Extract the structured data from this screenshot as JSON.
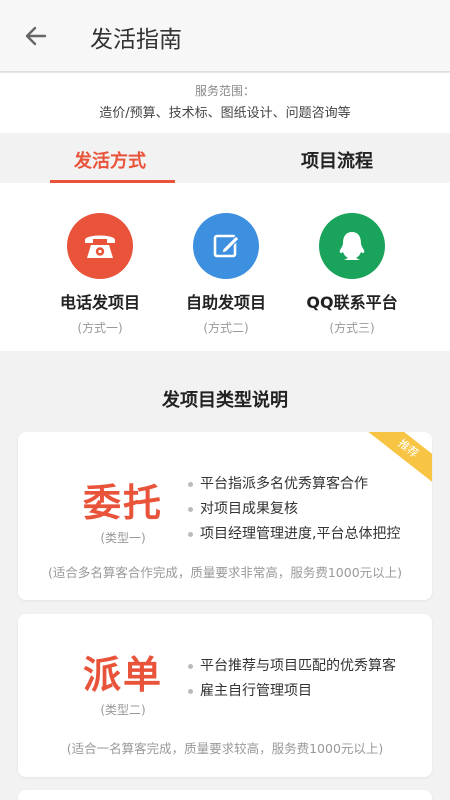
{
  "header": {
    "title": "发活指南",
    "back_icon": "arrow-left-icon"
  },
  "service": {
    "label": "服务范围：",
    "text": "造价/预算、技术标、图纸设计、问题咨询等"
  },
  "tabs": [
    {
      "label": "发活方式",
      "active": true
    },
    {
      "label": "项目流程",
      "active": false
    }
  ],
  "methods": [
    {
      "name": "电话发项目",
      "sub": "(方式一)",
      "icon": "phone-icon",
      "color": "#e8533a"
    },
    {
      "name": "自助发项目",
      "sub": "(方式二)",
      "icon": "edit-icon",
      "color": "#3d8fdf"
    },
    {
      "name": "QQ联系平台",
      "sub": "(方式三)",
      "icon": "qq-icon",
      "color": "#1aa35a"
    }
  ],
  "section_title": "发项目类型说明",
  "cards": [
    {
      "word": "委托",
      "type": "(类型一)",
      "ribbon": "推荐",
      "bullets": [
        "平台指派多名优秀算客合作",
        "对项目成果复核",
        "项目经理管理进度,平台总体把控"
      ],
      "note": "(适合多名算客合作完成，质量要求非常高，服务费1000元以上)"
    },
    {
      "word": "派单",
      "type": "(类型二)",
      "bullets": [
        "平台推荐与项目匹配的优秀算客",
        "雇主自行管理项目"
      ],
      "note": "(适合一名算客完成，质量要求较高，服务费1000元以上)"
    }
  ],
  "colors": {
    "accent": "#e8533a",
    "ribbon": "#f7c444"
  }
}
